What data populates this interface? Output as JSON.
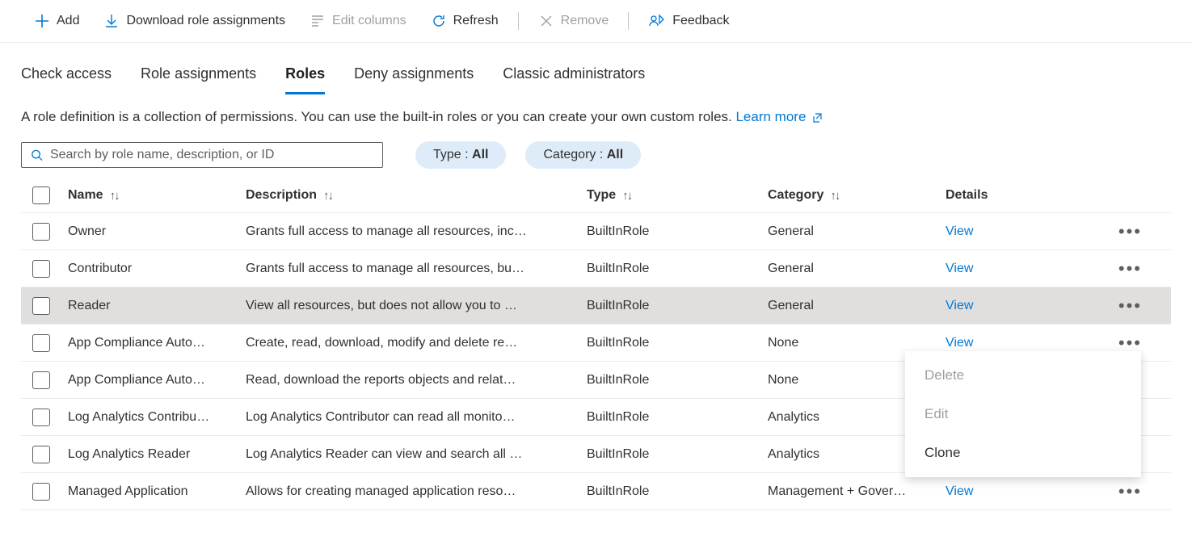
{
  "toolbar": {
    "add": "Add",
    "download": "Download role assignments",
    "editColumns": "Edit columns",
    "refresh": "Refresh",
    "remove": "Remove",
    "feedback": "Feedback"
  },
  "tabs": {
    "checkAccess": "Check access",
    "roleAssignments": "Role assignments",
    "roles": "Roles",
    "denyAssignments": "Deny assignments",
    "classicAdministrators": "Classic administrators"
  },
  "description": "A role definition is a collection of permissions. You can use the built-in roles or you can create your own custom roles. ",
  "learnMore": "Learn more",
  "search": {
    "placeholder": "Search by role name, description, or ID"
  },
  "filters": {
    "typeLabel": "Type : ",
    "typeValue": "All",
    "categoryLabel": "Category : ",
    "categoryValue": "All"
  },
  "columns": {
    "name": "Name",
    "description": "Description",
    "type": "Type",
    "category": "Category",
    "details": "Details"
  },
  "viewLabel": "View",
  "rows": [
    {
      "name": "Owner",
      "desc": "Grants full access to manage all resources, inc…",
      "type": "BuiltInRole",
      "category": "General",
      "highlighted": false
    },
    {
      "name": "Contributor",
      "desc": "Grants full access to manage all resources, bu…",
      "type": "BuiltInRole",
      "category": "General",
      "highlighted": false
    },
    {
      "name": "Reader",
      "desc": "View all resources, but does not allow you to …",
      "type": "BuiltInRole",
      "category": "General",
      "highlighted": true
    },
    {
      "name": "App Compliance Auto…",
      "desc": "Create, read, download, modify and delete re…",
      "type": "BuiltInRole",
      "category": "None",
      "highlighted": false
    },
    {
      "name": "App Compliance Auto…",
      "desc": "Read, download the reports objects and relat…",
      "type": "BuiltInRole",
      "category": "None",
      "highlighted": false
    },
    {
      "name": "Log Analytics Contribu…",
      "desc": "Log Analytics Contributor can read all monito…",
      "type": "BuiltInRole",
      "category": "Analytics",
      "highlighted": false
    },
    {
      "name": "Log Analytics Reader",
      "desc": "Log Analytics Reader can view and search all …",
      "type": "BuiltInRole",
      "category": "Analytics",
      "highlighted": false
    },
    {
      "name": "Managed Application",
      "desc": "Allows for creating managed application reso…",
      "type": "BuiltInRole",
      "category": "Management + Gover…",
      "highlighted": false
    }
  ],
  "contextMenu": {
    "delete": "Delete",
    "edit": "Edit",
    "clone": "Clone"
  }
}
